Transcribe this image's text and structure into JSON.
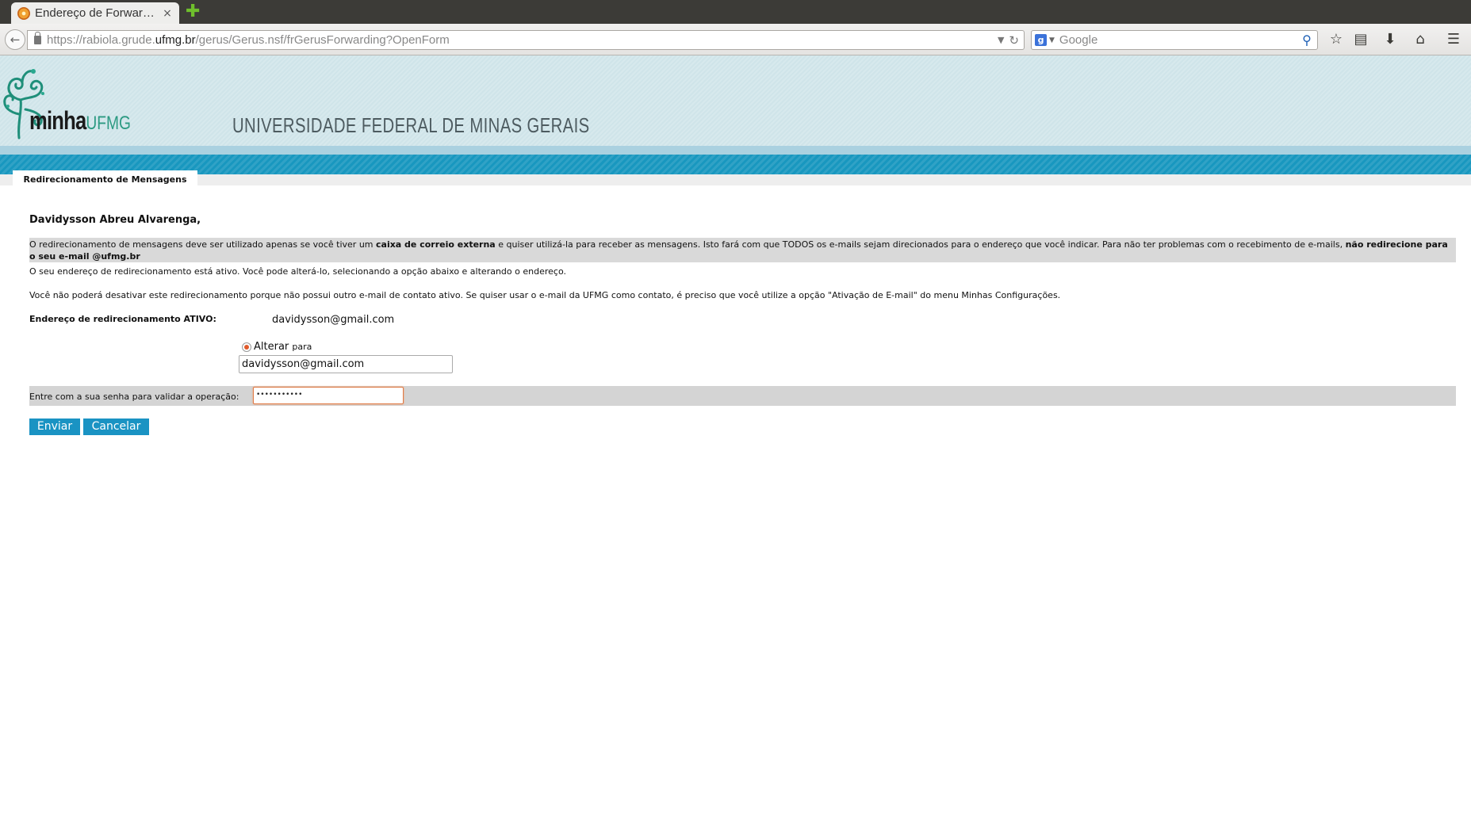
{
  "browser": {
    "tab_title": "Endereço de Forwar…",
    "tab_close": "×",
    "new_tab": "✚",
    "url_prefix": "https://rabiola.grude.",
    "url_domain": "ufmg.br",
    "url_path": "/gerus/Gerus.nsf/frGerusForwarding?OpenForm",
    "search_placeholder": "Google",
    "search_engine_letter": "g"
  },
  "header": {
    "logo_main": "minha",
    "logo_accent": "UFMG",
    "university": "UNIVERSIDADE FEDERAL DE MINAS GERAIS",
    "logo_color": "#2c9a82",
    "stripe_color": "#1897bf"
  },
  "page": {
    "tab_label": "Redirecionamento de Mensagens",
    "greeting": "Davidysson Abreu Alvarenga,",
    "notice_part1": "O redirecionamento de mensagens deve ser utilizado apenas se você tiver um ",
    "notice_bold1": "caixa de correio externa",
    "notice_part2": " e quiser utilizá-la para receber as mensagens. Isto fará com que TODOS os e-mails sejam direcionados para o endereço que você indicar. Para não ter problemas com o recebimento de e-mails, ",
    "notice_bold2": "não redirecione para o seu e-mail @ufmg.br",
    "active_info": "O seu endereço de redirecionamento está ativo. Você pode alterá-lo, selecionando a opção abaixo e alterando o endereço.",
    "cannot_disable": "Você não poderá desativar este redirecionamento porque não possui outro e-mail de contato ativo. Se quiser usar o e-mail da UFMG como contato, é preciso que você utilize a opção \"Ativação de E-mail\" do menu Minhas Configurações.",
    "active_address_label": "Endereço de redirecionamento ATIVO:",
    "active_address_value": "davidysson@gmail.com",
    "radio_label": "Alterar",
    "radio_suffix": "para",
    "new_address_value": "davidysson@gmail.com",
    "password_label": "Entre com a sua senha para validar a operação:",
    "password_value": "•••••••••••",
    "submit_label": "Enviar",
    "cancel_label": "Cancelar"
  }
}
